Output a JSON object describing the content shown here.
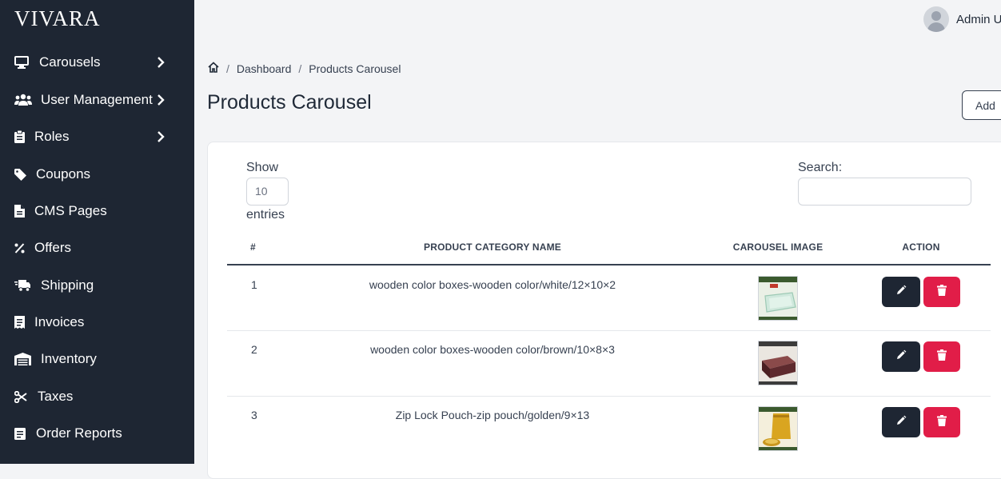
{
  "app": {
    "logo": "VIVARA"
  },
  "sidebar": {
    "items": [
      {
        "label": "Carousels",
        "icon": "monitor-icon",
        "has_submenu": true
      },
      {
        "label": "User Management",
        "icon": "users-icon",
        "has_submenu": true
      },
      {
        "label": "Roles",
        "icon": "clipboard-icon",
        "has_submenu": true
      },
      {
        "label": "Coupons",
        "icon": "tag-icon",
        "has_submenu": false
      },
      {
        "label": "CMS Pages",
        "icon": "file-icon",
        "has_submenu": false
      },
      {
        "label": "Offers",
        "icon": "percent-icon",
        "has_submenu": false
      },
      {
        "label": "Shipping",
        "icon": "truck-icon",
        "has_submenu": false
      },
      {
        "label": "Invoices",
        "icon": "receipt-icon",
        "has_submenu": false
      },
      {
        "label": "Inventory",
        "icon": "warehouse-icon",
        "has_submenu": false
      },
      {
        "label": "Taxes",
        "icon": "scissors-icon",
        "has_submenu": false
      },
      {
        "label": "Order Reports",
        "icon": "report-icon",
        "has_submenu": false
      }
    ]
  },
  "header": {
    "user_name": "Admin U"
  },
  "breadcrumb": {
    "items": [
      "Dashboard",
      "Products Carousel"
    ]
  },
  "page": {
    "title": "Products Carousel",
    "add_button": "Add"
  },
  "table_controls": {
    "show_label": "Show",
    "entries_value": "10",
    "entries_label": "entries",
    "search_label": "Search:",
    "search_value": ""
  },
  "table": {
    "headers": [
      "#",
      "PRODUCT CATEGORY NAME",
      "CAROUSEL IMAGE",
      "ACTION"
    ],
    "rows": [
      {
        "index": "1",
        "name": "wooden color boxes-wooden color/white/12×10×2",
        "image_alt": "white tray thumbnail"
      },
      {
        "index": "2",
        "name": "wooden color boxes-wooden color/brown/10×8×3",
        "image_alt": "brown box thumbnail"
      },
      {
        "index": "3",
        "name": "Zip Lock Pouch-zip pouch/golden/9×13",
        "image_alt": "golden pouch thumbnail"
      }
    ]
  },
  "colors": {
    "sidebar_bg": "#1e2633",
    "edit_button": "#1e2633",
    "delete_button": "#e11d48",
    "page_bg": "#f3f4f6"
  }
}
